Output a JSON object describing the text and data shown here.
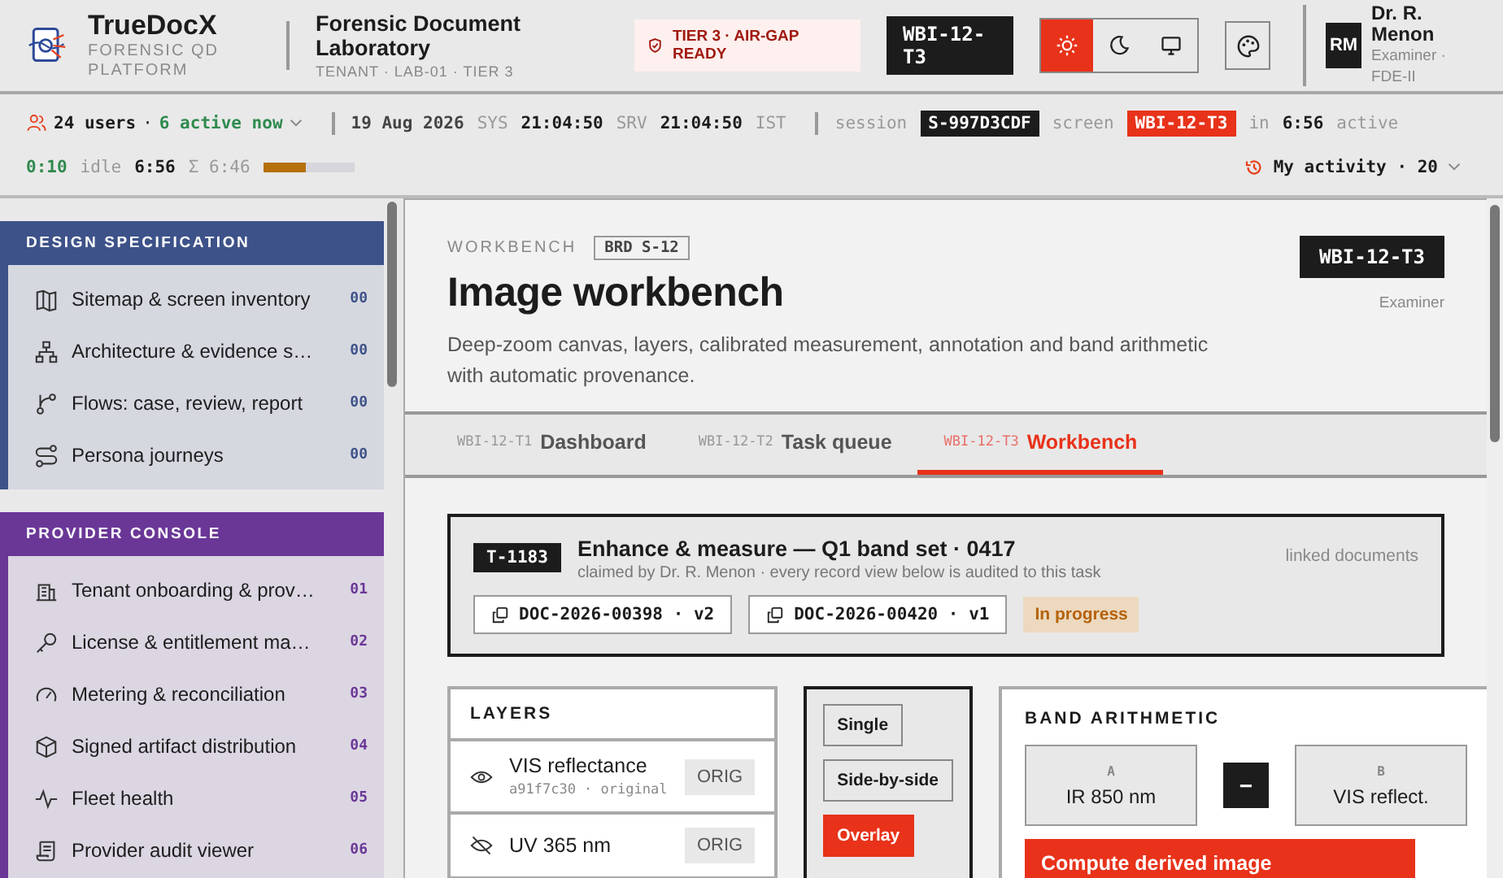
{
  "brand": {
    "name": "TrueDocX",
    "tagline": "FORENSIC QD PLATFORM"
  },
  "lab": {
    "name": "Forensic Document Laboratory",
    "tenant": "TENANT · LAB-01 · TIER 3"
  },
  "tier_badge": "TIER 3 · AIR-GAP READY",
  "screen_code": "WBI-12-T3",
  "theme_modes": [
    {
      "kind": "light",
      "selected": true
    },
    {
      "kind": "dark",
      "selected": false
    },
    {
      "kind": "system",
      "selected": false
    }
  ],
  "user": {
    "initials": "RM",
    "name": "Dr. R. Menon",
    "role": "Examiner · FDE-II"
  },
  "status_bar": {
    "users": "24 users",
    "users_sep": "·",
    "active": "6 active now",
    "date": "19 Aug 2026",
    "sys_label": "SYS",
    "sys_time": "21:04:50",
    "srv_label": "SRV",
    "srv_time": "21:04:50",
    "tz": "IST",
    "session_label": "session",
    "session": "S-997D3CDF",
    "screen_label": "screen",
    "screen": "WBI-12-T3",
    "in_label": "in",
    "in_time": "6:56",
    "active_label": "active",
    "active_time": "0:10",
    "idle_label": "idle",
    "idle_time": "6:56",
    "sum_label": "Σ 6:46",
    "level": 0.46,
    "activity": "My activity · 20"
  },
  "sidebar": [
    {
      "title": "DESIGN SPECIFICATION",
      "color": "#3d5289",
      "items": [
        {
          "label": "Sitemap & screen inventory",
          "count": "00"
        },
        {
          "label": "Architecture & evidence s…",
          "count": "00"
        },
        {
          "label": "Flows: case, review, report",
          "count": "00"
        },
        {
          "label": "Persona journeys",
          "count": "00"
        }
      ]
    },
    {
      "title": "PROVIDER CONSOLE",
      "color": "#6a3797",
      "items": [
        {
          "label": "Tenant onboarding & prov…",
          "count": "01"
        },
        {
          "label": "License & entitlement ma…",
          "count": "02"
        },
        {
          "label": "Metering & reconciliation",
          "count": "03"
        },
        {
          "label": "Signed artifact distribution",
          "count": "04"
        },
        {
          "label": "Fleet health",
          "count": "05"
        },
        {
          "label": "Provider audit viewer",
          "count": "06"
        }
      ]
    }
  ],
  "page": {
    "eyebrow": "WORKBENCH",
    "ref": "BRD S-12",
    "title": "Image workbench",
    "description": "Deep-zoom canvas, layers, calibrated measurement, annotation and band arithmetic with automatic provenance.",
    "code": "WBI-12-T3",
    "role": "Examiner"
  },
  "tabs": [
    {
      "code": "WBI-12-T1",
      "label": "Dashboard",
      "selected": false
    },
    {
      "code": "WBI-12-T2",
      "label": "Task queue",
      "selected": false
    },
    {
      "code": "WBI-12-T3",
      "label": "Workbench",
      "selected": true
    }
  ],
  "task": {
    "id": "T-1183",
    "title": "Enhance & measure — Q1 band set · 0417",
    "subtitle": "claimed by Dr. R. Menon · every record view below is audited to this task",
    "linked_label": "linked documents",
    "documents": [
      "DOC-2026-00398 · v2",
      "DOC-2026-00420 · v1"
    ],
    "status": "In progress"
  },
  "layers": {
    "title": "LAYERS",
    "items": [
      {
        "name": "VIS reflectance",
        "meta": "a91f7c30 · original",
        "tag": "ORIG",
        "visible": true
      },
      {
        "name": "UV 365 nm",
        "tag": "ORIG",
        "visible": false
      }
    ]
  },
  "view_modes": [
    {
      "label": "Single",
      "selected": false
    },
    {
      "label": "Side-by-side",
      "selected": false
    },
    {
      "label": "Overlay",
      "selected": true
    }
  ],
  "band": {
    "title": "BAND ARITHMETIC",
    "a_label": "A",
    "a_value": "IR 850 nm",
    "operator": "−",
    "b_label": "B",
    "b_value": "VIS reflect.",
    "action": "Compute derived image"
  }
}
